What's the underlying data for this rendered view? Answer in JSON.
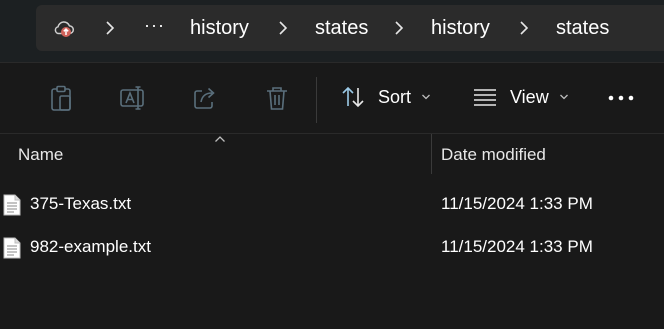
{
  "breadcrumb": {
    "root_icon": "cloud-upload-icon",
    "overflow": "···",
    "items": [
      "history",
      "states",
      "history",
      "states"
    ]
  },
  "toolbar": {
    "buttons": [
      "clipboard-icon",
      "rename-icon",
      "share-icon",
      "delete-icon"
    ],
    "sort_label": "Sort",
    "view_label": "View",
    "more_icon": "more-icon"
  },
  "columns": {
    "name": "Name",
    "date_modified": "Date modified"
  },
  "files": [
    {
      "name": "375-Texas.txt",
      "date_modified": "11/15/2024 1:33 PM"
    },
    {
      "name": "982-example.txt",
      "date_modified": "11/15/2024 1:33 PM"
    }
  ],
  "colors": {
    "background": "#191919",
    "address_bar": "#2b2b2b",
    "icon_disabled": "#5a6f7c",
    "text": "#ffffff"
  }
}
